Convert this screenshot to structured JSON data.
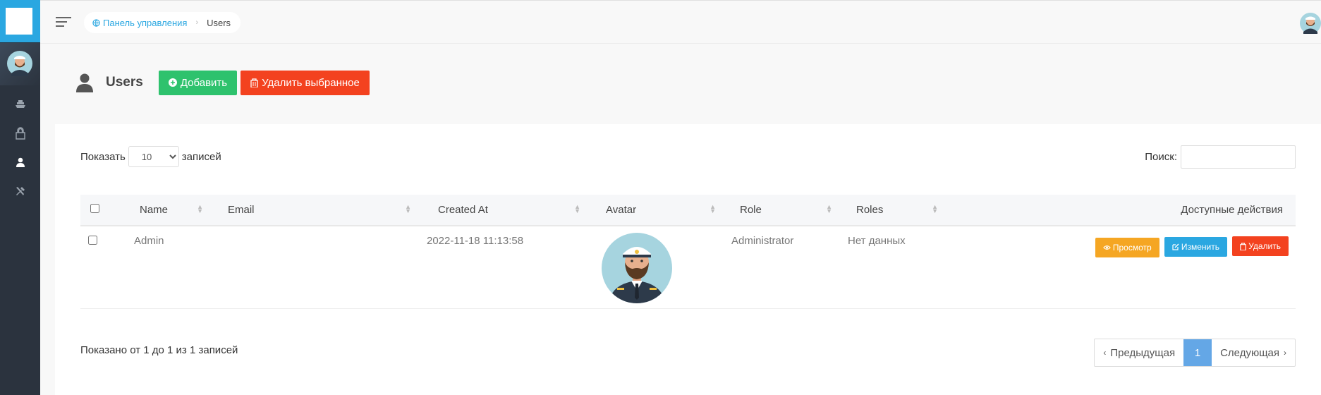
{
  "header": {
    "breadcrumb_home": "Панель управления",
    "breadcrumb_current": "Users"
  },
  "page": {
    "title": "Users",
    "add_button": "Добавить",
    "delete_selected_button": "Удалить выбранное"
  },
  "table_controls": {
    "show_label": "Показать",
    "page_size": "10",
    "entries_label": "записей",
    "search_label": "Поиск:"
  },
  "table": {
    "columns": [
      "Name",
      "Email",
      "Created At",
      "Avatar",
      "Role",
      "Roles",
      "Доступные действия"
    ],
    "rows": [
      {
        "name": "Admin",
        "email": "",
        "created_at": "2022-11-18 11:13:58",
        "role": "Administrator",
        "roles": "Нет данных",
        "view": "Просмотр",
        "edit": "Изменить",
        "delete": "Удалить"
      }
    ]
  },
  "footer": {
    "info": "Показано от 1 до 1 из 1 записей",
    "prev": "Предыдущая",
    "page": "1",
    "next": "Следующая"
  },
  "sidebar": {
    "icons": [
      "ship-icon",
      "lock-icon",
      "user-icon",
      "tools-icon"
    ],
    "active_icon": "user-icon"
  },
  "colors": {
    "sidebar_bg": "#2b333e",
    "brand": "#2aa7e1",
    "add_button": "#2ec26d",
    "danger": "#f3421f",
    "view_button": "#f5a623",
    "pager_active": "#64a7e6"
  }
}
